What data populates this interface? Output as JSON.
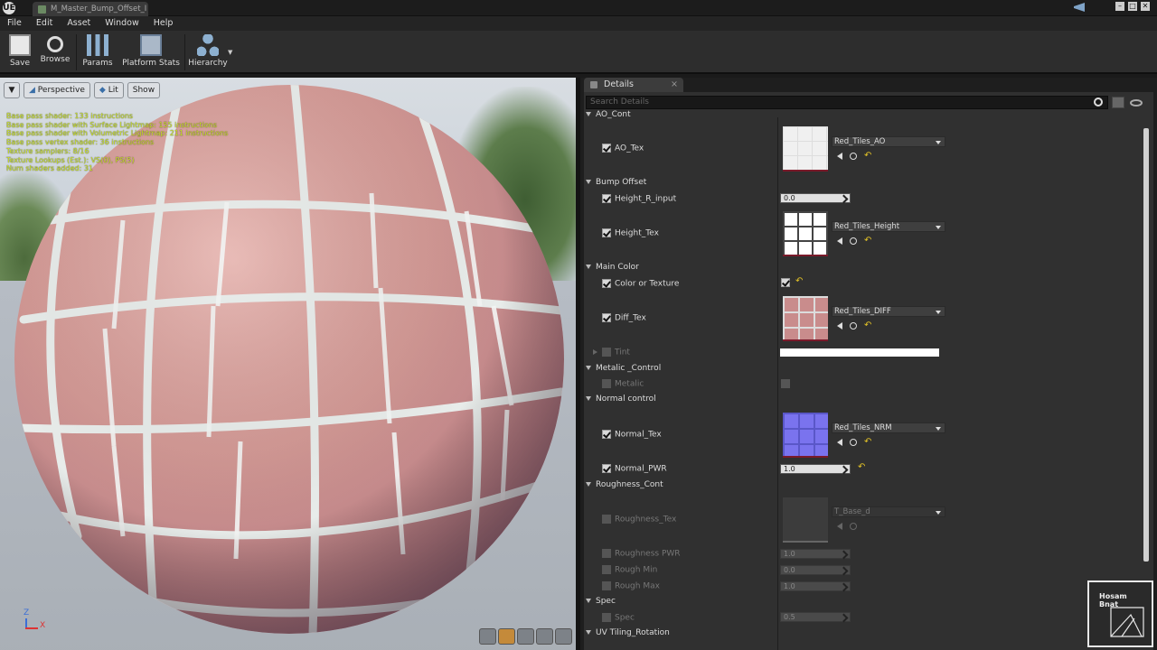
{
  "window": {
    "tab_title": "M_Master_Bump_Offset_I",
    "logo": "UE"
  },
  "menu": [
    "File",
    "Edit",
    "Asset",
    "Window",
    "Help"
  ],
  "toolbar": {
    "save": "Save",
    "browse": "Browse",
    "params": "Params",
    "platform_stats": "Platform Stats",
    "hierarchy": "Hierarchy"
  },
  "viewport": {
    "perspective": "Perspective",
    "lit": "Lit",
    "show": "Show",
    "stats": [
      "Base pass shader: 133 instructions",
      "Base pass shader with Surface Lightmap: 155 instructions",
      "Base pass shader with Volumetric Lightmap: 211 instructions",
      "Base pass vertex shader: 36 instructions",
      "Texture samplers: 8/16",
      "Texture Lookups (Est.): VS(0), PS(5)",
      "Num shaders added: 31"
    ],
    "axis_z": "Z",
    "axis_x": "X"
  },
  "details": {
    "tab": "Details",
    "search_placeholder": "Search Details",
    "categories": {
      "ao": "AO_Cont",
      "bump": "Bump Offset",
      "main_color": "Main Color",
      "metallic": "Metalic _Control",
      "normal": "Normal control",
      "roughness": "Roughness_Cont",
      "spec": "Spec",
      "uv": "UV Tiling_Rotation"
    },
    "props": {
      "ao_tex": "AO_Tex",
      "height_r": "Height_R_input",
      "height_tex": "Height_Tex",
      "color_or_texture": "Color or Texture",
      "diff_tex": "Diff_Tex",
      "tint": "Tint",
      "metalic": "Metalic",
      "normal_tex": "Normal_Tex",
      "normal_pwr": "Normal_PWR",
      "roughness_tex": "Roughness_Tex",
      "roughness_pwr": "Roughness PWR",
      "rough_min": "Rough Min",
      "rough_max": "Rough Max",
      "spec": "Spec"
    },
    "values": {
      "ao_asset": "Red_Tiles_AO",
      "height_r": "0.0",
      "height_asset": "Red_Tiles_Height",
      "diff_asset": "Red_Tiles_DIFF",
      "normal_asset": "Red_Tiles_NRM",
      "normal_pwr": "1.0",
      "rough_asset": "T_Base_d",
      "roughness_pwr": "1.0",
      "rough_min": "0.0",
      "rough_max": "1.0",
      "spec": "0.5"
    }
  },
  "watermark": {
    "line1": "Hosam",
    "line2": "Bnat"
  },
  "colors": {
    "accent_yellow": "#e0c027",
    "stats_text": "#cfe72b",
    "tint": "#ffffff"
  }
}
